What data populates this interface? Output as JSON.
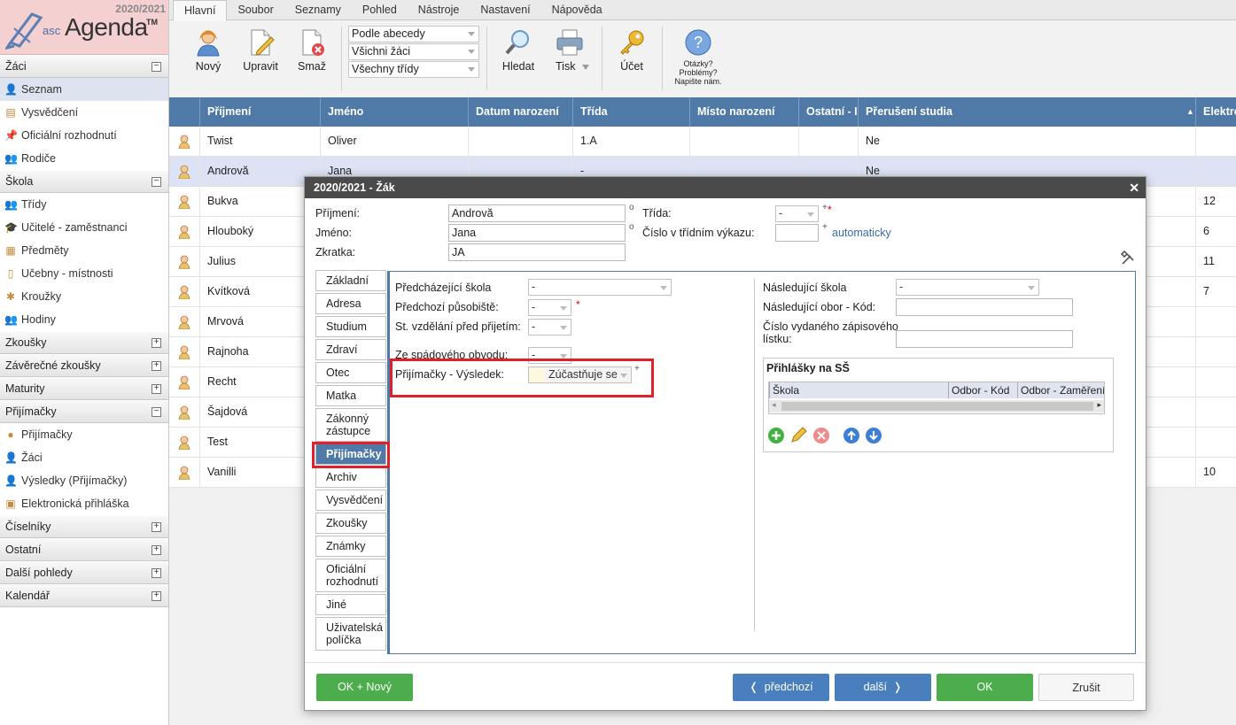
{
  "app": {
    "logo_prefix": "asc",
    "logo_name": "Agenda",
    "logo_tm": "TM",
    "year": "2020/2021"
  },
  "sidebar": {
    "sections": [
      {
        "label": "Žáci",
        "expanded": true,
        "items": [
          "Seznam",
          "Vysvědčení",
          "Oficiální rozhodnutí",
          "Rodiče"
        ]
      },
      {
        "label": "Škola",
        "expanded": true,
        "items": [
          "Třídy",
          "Učitelé - zaměstnanci",
          "Předměty",
          "Učebny - místnosti",
          "Kroužky",
          "Hodiny"
        ]
      },
      {
        "label": "Zkoušky",
        "expanded": false,
        "items": []
      },
      {
        "label": "Závěrečné zkoušky",
        "expanded": false,
        "items": []
      },
      {
        "label": "Maturity",
        "expanded": false,
        "items": []
      },
      {
        "label": "Přijímačky",
        "expanded": true,
        "items": [
          "Přijímačky",
          "Žáci",
          "Výsledky (Přijímačky)",
          "Elektronická přihláška"
        ]
      },
      {
        "label": "Číselníky",
        "expanded": false,
        "items": []
      },
      {
        "label": "Ostatní",
        "expanded": false,
        "items": []
      },
      {
        "label": "Další pohledy",
        "expanded": false,
        "items": []
      },
      {
        "label": "Kalendář",
        "expanded": false,
        "items": []
      }
    ],
    "collapse_symbol": "−",
    "expand_symbol": "+"
  },
  "menu": [
    "Hlavní",
    "Soubor",
    "Seznamy",
    "Pohled",
    "Nástroje",
    "Nastavení",
    "Nápověda"
  ],
  "toolbar": {
    "new": "Nový",
    "edit": "Upravit",
    "delete": "Smaž",
    "sort": "Podle abecedy",
    "filter_students": "Všichni žáci",
    "filter_classes": "Všechny třídy",
    "search": "Hledat",
    "print": "Tisk",
    "account": "Účet",
    "help_line1": "Otázky?",
    "help_line2": "Problémy?",
    "help_line3": "Napište nám."
  },
  "grid": {
    "columns": [
      "Příjmení",
      "Jméno",
      "Datum narození",
      "Třída",
      "Místo narození",
      "Ostatní - II",
      "Přerušení studia",
      "Elektro"
    ],
    "rows": [
      [
        "Twist",
        "Oliver",
        "",
        "1.A",
        "",
        "",
        "Ne",
        ""
      ],
      [
        "Androvă",
        "Jana",
        "",
        "-",
        "",
        "",
        "Ne",
        ""
      ],
      [
        "Bukva",
        "",
        "",
        "",
        "",
        "",
        "",
        "12"
      ],
      [
        "Hlouboký",
        "",
        "",
        "",
        "",
        "",
        "",
        "6"
      ],
      [
        "Julius",
        "",
        "",
        "",
        "",
        "",
        "",
        "11"
      ],
      [
        "Kvítková",
        "",
        "",
        "",
        "",
        "",
        "",
        "7"
      ],
      [
        "Mrvová",
        "",
        "",
        "",
        "",
        "",
        "",
        ""
      ],
      [
        "Rajnoha",
        "",
        "",
        "",
        "",
        "",
        "",
        ""
      ],
      [
        "Recht",
        "",
        "",
        "",
        "",
        "",
        "",
        ""
      ],
      [
        "Šajdová",
        "",
        "",
        "",
        "",
        "",
        "",
        ""
      ],
      [
        "Test",
        "",
        "",
        "",
        "",
        "",
        "",
        ""
      ],
      [
        "Vanilli",
        "",
        "",
        "",
        "",
        "",
        "",
        "10"
      ]
    ]
  },
  "dialog": {
    "title": "2020/2021 - Žák",
    "close": "✕",
    "surname_label": "Příjmení:",
    "surname": "Androvă",
    "name_label": "Jméno:",
    "name": "Jana",
    "abbr_label": "Zkratka:",
    "abbr": "JA",
    "class_label": "Třída:",
    "class_value": "-",
    "class_no_label": "Číslo v třídním výkazu:",
    "automatic": "automaticky",
    "circle": "o",
    "plus": "+",
    "star": "*",
    "tabs": [
      "Základní",
      "Adresa",
      "Studium",
      "Zdraví",
      "Otec",
      "Matka",
      "Zákonný zástupce",
      "Přijímačky",
      "Archiv",
      "Vysvědčení",
      "Zkoušky",
      "Známky",
      "Oficiální rozhodnutí",
      "Jiné",
      "Uživatelská políčka"
    ],
    "active_tab": "Přijímačky",
    "prev_school_label": "Předcházející škola",
    "prev_school": "-",
    "prev_work_label": "Předchozí působiště:",
    "prev_work": "-",
    "edu_label": "St. vzdělání před přijetím:",
    "edu": "-",
    "district_label": "Ze spádového obvodu:",
    "district": "-",
    "result_label": "Přijímačky - Výsledek:",
    "result": "Zúčastňuje se",
    "next_school_label": "Následující škola",
    "next_school": "-",
    "next_field_label": "Následující obor - Kód:",
    "card_label_1": "Číslo vydaného zápisového",
    "card_label_2": "lístku:",
    "applications_title": "Přihlášky na SŠ",
    "app_cols": [
      "Škola",
      "Odbor - Kód",
      "Odbor - Zaměření"
    ],
    "ok_new": "OK + Nový",
    "prev": "předchozí",
    "next": "další",
    "ok": "OK",
    "cancel": "Zrušit"
  },
  "colors": {
    "header_blue": "#4f79a6",
    "highlight_red": "#e0202a",
    "ok_green": "#4cad4c",
    "nav_blue": "#4a7fbd"
  }
}
